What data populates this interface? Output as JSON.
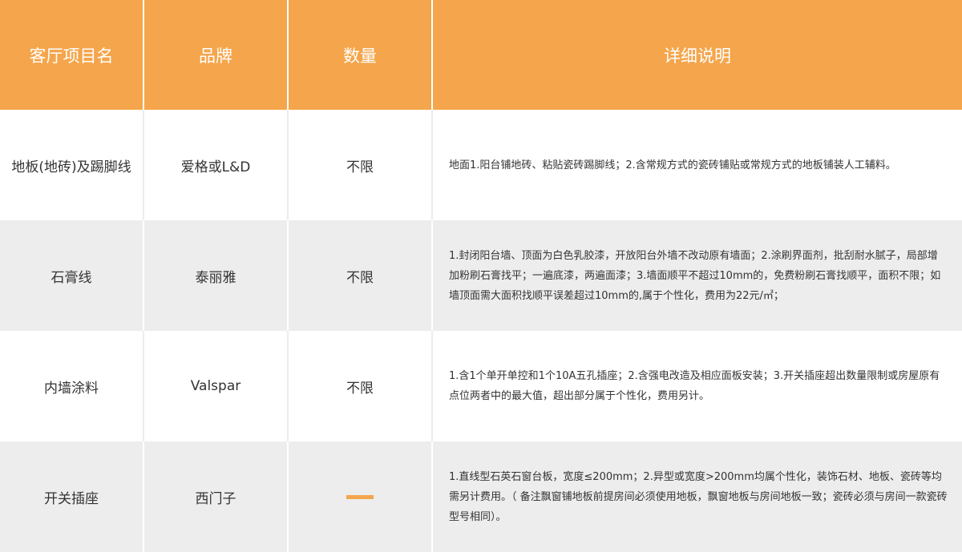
{
  "header": {
    "col_item": "客厅项目名",
    "col_brand": "品牌",
    "col_qty": "数量",
    "col_desc": "详细说明"
  },
  "rows": [
    {
      "item": "地板(地砖)及踢脚线",
      "brand": "爱格或L&D",
      "qty": "不限",
      "desc": "地面1.阳台铺地砖、粘贴瓷砖踢脚线；2.含常规方式的瓷砖铺贴或常规方式的地板铺装人工辅料。"
    },
    {
      "item": "石膏线",
      "brand": "泰丽雅",
      "qty": "不限",
      "desc": "1.封闭阳台墙、顶面为白色乳胶漆，开放阳台外墙不改动原有墙面；2.涂刷界面剂，批刮耐水腻子，局部增加粉刷石膏找平；一遍底漆，两遍面漆；3.墙面顺平不超过10mm的，免费粉刷石膏找顺平，面积不限；如墙顶面需大面积找顺平误差超过10mm的,属于个性化，费用为22元/㎡；"
    },
    {
      "item": "内墙涂料",
      "brand": "Valspar",
      "qty": "不限",
      "desc": "1.含1个单开单控和1个10A五孔插座；2.含强电改造及相应面板安装；3.开关插座超出数量限制或房屋原有点位两者中的最大值，超出部分属于个性化，费用另计。"
    },
    {
      "item": "开关插座",
      "brand": "西门子",
      "qty": "",
      "desc": "1.直线型石英石窗台板，宽度≤200mm；2.异型或宽度>200mm均属个性化，装饰石材、地板、瓷砖等均需另计费用。（ 备注飘窗铺地板前提房间必须使用地板，飘窗地板与房间地板一致；瓷砖必须与房间一款瓷砖型号相同）。"
    }
  ],
  "colors": {
    "header_bg": "#f5a54b",
    "alt_row_bg": "#ededed",
    "text": "#333333",
    "dash": "#f5a54b"
  }
}
